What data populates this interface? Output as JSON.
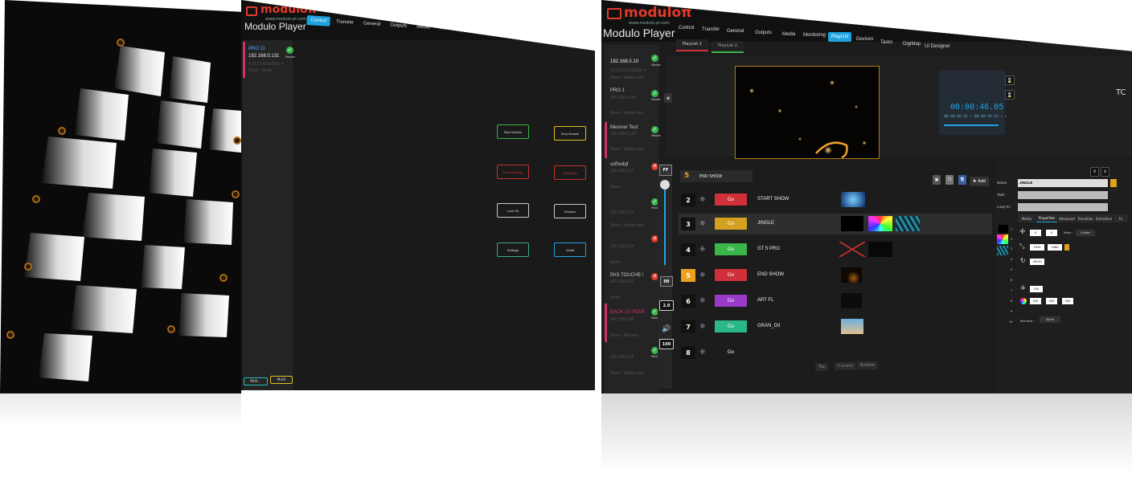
{
  "brand": {
    "name": "modulo",
    "pi": "π",
    "url": "www.modulo-pi.com",
    "app": "Modulo Player",
    "accent": "#e23a2a",
    "tab_active": "#1ea3e0"
  },
  "tabs_p2": [
    "Control",
    "Transfer",
    "General",
    "Outputs",
    "Media",
    "Monitoring",
    "PlayList",
    "Devices",
    "Tasks",
    "DigiMap",
    "UI Designer"
  ],
  "tabs_p3": [
    "Control",
    "Transfer",
    "General",
    "Outputs",
    "Media",
    "Monitoring",
    "PlayList",
    "Devices",
    "Tasks",
    "DigiMap",
    "UI Designer"
  ],
  "p2": {
    "device": {
      "name": "PRO 11",
      "ip": "192.168.0.131",
      "version": "4.11.5 24/11/2015 4",
      "show": "Show : Moviii",
      "status": "Master"
    },
    "control_buttons": [
      {
        "label": "Start Module",
        "color": "#3ab54a"
      },
      {
        "label": "Stop Module",
        "color": "#e0c020"
      },
      {
        "label": "Reset Display",
        "color": "#c83030"
      },
      {
        "label": "Shutdown",
        "color": "#c83030"
      },
      {
        "label": "Lock Ok",
        "color": "#cccccc"
      },
      {
        "label": "Session",
        "color": "#cccccc"
      },
      {
        "label": "Settings",
        "color": "#3aa88a"
      },
      {
        "label": "Install",
        "color": "#1ea3e0"
      }
    ],
    "bottom_buttons": [
      {
        "label": "Midi...",
        "color": "#2ac0c0"
      },
      {
        "label": "Multi",
        "color": "#e0c020"
      }
    ]
  },
  "p3": {
    "playlist_tabs": [
      "PlayList 1",
      "PlayList 2"
    ],
    "devices": [
      {
        "name": "192.168.0.10",
        "ip": "",
        "version": "4.12.2 21/03/2016 4",
        "show": "Show : default.smi",
        "status": "ok",
        "master": "Master",
        "accent": ""
      },
      {
        "name": "PRO 1",
        "ip": "192.168.0.121",
        "version": "",
        "show": "Show : default.smi",
        "status": "ok",
        "master": "Master",
        "accent": ""
      },
      {
        "name": "Mesmer Test",
        "ip": "192.168.0.124",
        "version": "",
        "show": "Show : default.smi",
        "status": "ok",
        "master": "Master",
        "accent": "#d0306a"
      },
      {
        "name": "ssfhsdqf",
        "ip": "192.168.0.17",
        "version": "",
        "show": "Show :",
        "status": "bad",
        "master": "",
        "accent": ""
      },
      {
        "name": "",
        "ip": "192.168.0.27",
        "version": "",
        "show": "Show : default.smi",
        "status": "ok",
        "master": "Master",
        "accent": ""
      },
      {
        "name": "",
        "ip": "192.168.0.34",
        "version": "",
        "show": "Show :",
        "status": "bad",
        "master": "",
        "accent": ""
      },
      {
        "name": "PAS TOUCHE !",
        "ip": "192.168.0.35",
        "version": "",
        "show": "Show :",
        "status": "bad",
        "master": "",
        "accent": ""
      },
      {
        "name": "BACK 2U HDMI",
        "ip": "192.168.0.38",
        "version": "",
        "show": "Show : Pictures",
        "status": "ok",
        "master": "Master",
        "accent": "#d0306a"
      },
      {
        "name": "",
        "ip": "192.168.0.78",
        "version": "",
        "show": "Show : default.smi",
        "status": "ok",
        "master": "Master",
        "accent": ""
      }
    ],
    "timecode": {
      "main": "00:00:46.05",
      "sub": "00:00:46.05 / 00:00:49.23 ▸ ▸",
      "tc_label": "TC"
    },
    "current_cue": {
      "number": "5",
      "name": "END SHOW"
    },
    "add_label": "Add",
    "cues": [
      {
        "num": "2",
        "go": "Go",
        "color": "#d0303a",
        "name": "START SHOW"
      },
      {
        "num": "3",
        "go": "Go",
        "color": "#d4a020",
        "name": "JINGLE"
      },
      {
        "num": "4",
        "go": "Go",
        "color": "#3ab54a",
        "name": "GT 5 PRO"
      },
      {
        "num": "5",
        "go": "Go",
        "color": "#d0303a",
        "name": "END SHOW"
      },
      {
        "num": "6",
        "go": "Go",
        "color": "#9a3ac8",
        "name": "ART FL"
      },
      {
        "num": "7",
        "go": "Go",
        "color": "#2ab88a",
        "name": "GRAN_DII"
      },
      {
        "num": "8",
        "go": "Go",
        "color": "#1c1c1c",
        "name": ""
      }
    ],
    "side_controls": {
      "ff": "FF",
      "zero": "00",
      "speed": "2.0",
      "volume": "100"
    },
    "bottom_nav": [
      "Top",
      "Current",
      "Bottom"
    ],
    "props": {
      "name_label": "Name :",
      "name_value": "JINGLE",
      "task_label": "Task :",
      "loop_label": "Loop To :",
      "tabs": [
        "Media",
        "Properties",
        "Advanced",
        "Transition",
        "Animation",
        "Fx"
      ],
      "layers": [
        "1",
        "2",
        "3",
        "4",
        "5",
        "6",
        "7",
        "8",
        "9",
        "10"
      ],
      "pos": {
        "x": "0",
        "y": "0",
        "mode_label": "Mode :",
        "mode": "Center"
      },
      "size": {
        "x": "1920",
        "y": "1080"
      },
      "rotation": "-65.00",
      "opacity": "100",
      "rgba": {
        "r": "255",
        "g": "255",
        "b": "255"
      },
      "blending_label": "Blending :",
      "blending": "Alpha"
    }
  }
}
